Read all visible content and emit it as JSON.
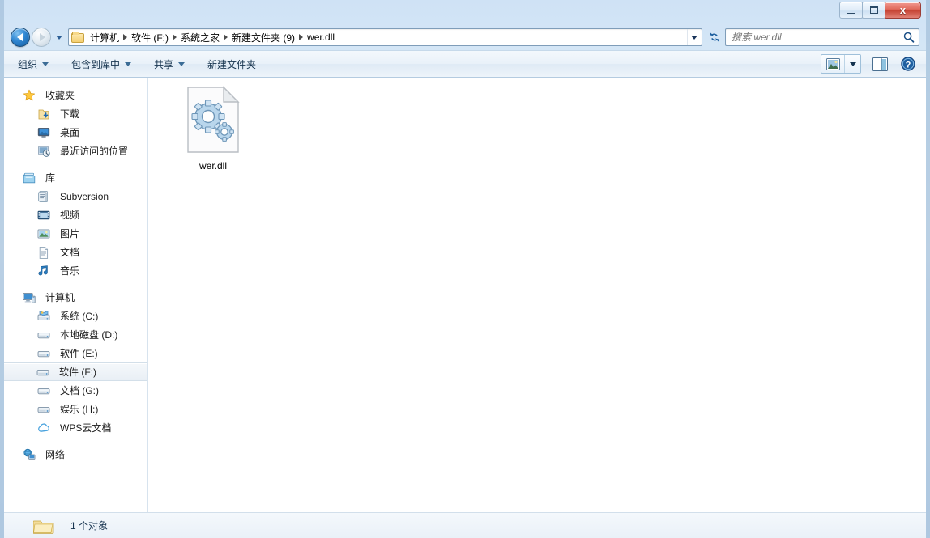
{
  "window": {
    "controls": {
      "minimize_label": "",
      "maximize_label": "",
      "close_label": "x"
    }
  },
  "address_bar": {
    "back_tooltip": "后退",
    "forward_tooltip": "前进",
    "breadcrumbs": [
      "计算机",
      "软件 (F:)",
      "系统之家",
      "新建文件夹 (9)",
      "wer.dll"
    ],
    "refresh_tooltip": "刷新"
  },
  "search": {
    "placeholder": "搜索 wer.dll",
    "value": ""
  },
  "command_bar": {
    "items": [
      {
        "label": "组织",
        "has_dropdown": true
      },
      {
        "label": "包含到库中",
        "has_dropdown": true
      },
      {
        "label": "共享",
        "has_dropdown": true
      },
      {
        "label": "新建文件夹",
        "has_dropdown": false
      }
    ],
    "view_button_tooltip": "更改您的视图",
    "preview_pane_tooltip": "显示预览窗格",
    "help_tooltip": "获取帮助"
  },
  "sidebar": {
    "groups": [
      {
        "root": {
          "label": "收藏夹",
          "icon": "star-icon"
        },
        "items": [
          {
            "label": "下载",
            "icon": "downloads-icon"
          },
          {
            "label": "桌面",
            "icon": "desktop-icon"
          },
          {
            "label": "最近访问的位置",
            "icon": "recent-places-icon"
          }
        ]
      },
      {
        "root": {
          "label": "库",
          "icon": "library-icon"
        },
        "items": [
          {
            "label": "Subversion",
            "icon": "subversion-icon"
          },
          {
            "label": "视频",
            "icon": "video-icon"
          },
          {
            "label": "图片",
            "icon": "pictures-icon"
          },
          {
            "label": "文档",
            "icon": "documents-icon"
          },
          {
            "label": "音乐",
            "icon": "music-icon"
          }
        ]
      },
      {
        "root": {
          "label": "计算机",
          "icon": "computer-icon"
        },
        "items": [
          {
            "label": "系统 (C:)",
            "icon": "system-drive-icon",
            "selected": false
          },
          {
            "label": "本地磁盘 (D:)",
            "icon": "drive-icon",
            "selected": false
          },
          {
            "label": "软件 (E:)",
            "icon": "drive-icon",
            "selected": false
          },
          {
            "label": "软件 (F:)",
            "icon": "drive-icon",
            "selected": true
          },
          {
            "label": "文档 (G:)",
            "icon": "drive-icon",
            "selected": false
          },
          {
            "label": "娱乐 (H:)",
            "icon": "drive-icon",
            "selected": false
          },
          {
            "label": "WPS云文档",
            "icon": "cloud-icon",
            "selected": false
          }
        ]
      },
      {
        "root": {
          "label": "网络",
          "icon": "network-icon"
        },
        "items": []
      }
    ]
  },
  "content": {
    "files": [
      {
        "name": "wer.dll",
        "icon": "dll-gears-icon"
      }
    ]
  },
  "status_bar": {
    "text": "1 个对象",
    "icon": "folder-icon"
  },
  "colors": {
    "accent": "#2f86d2",
    "close_button": "#c33f2f",
    "selection": "#e9eff5",
    "folder_yellow": "#f4cf72"
  }
}
